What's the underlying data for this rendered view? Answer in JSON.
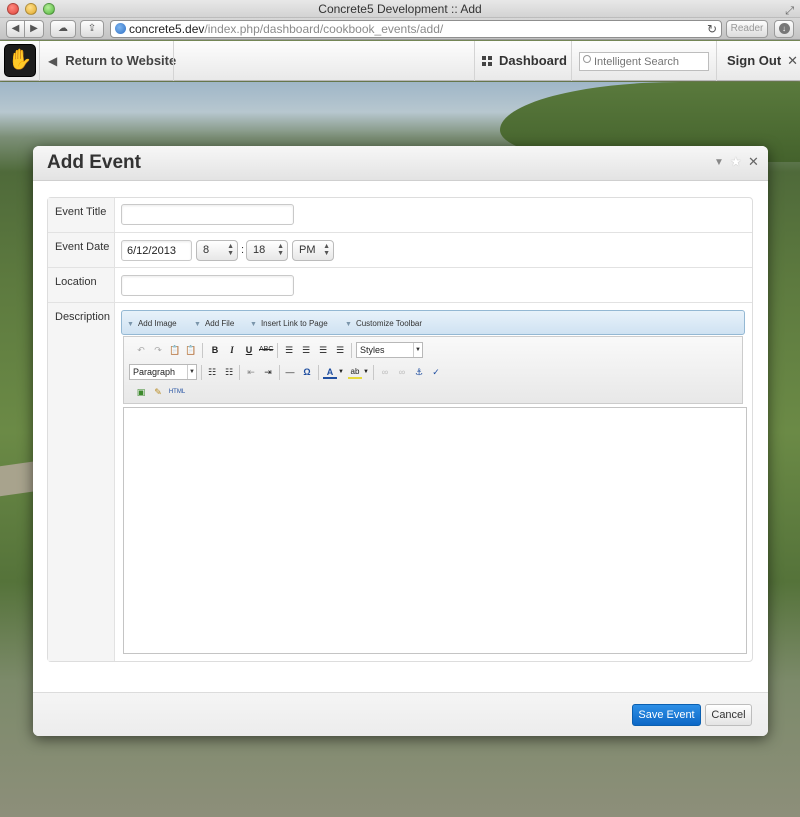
{
  "browser": {
    "window_title": "Concrete5 Development :: Add",
    "url_host": "concrete5.dev",
    "url_path": "/index.php/dashboard/cookbook_events/add/",
    "reader_label": "Reader"
  },
  "c5bar": {
    "return_label": "Return to Website",
    "dashboard_label": "Dashboard",
    "search_placeholder": "Intelligent Search",
    "signout_label": "Sign Out"
  },
  "dialog": {
    "title": "Add Event",
    "fields": {
      "title_label": "Event Title",
      "title_value": "",
      "date_label": "Event Date",
      "date_value": "6/12/2013",
      "hour_value": "8",
      "colon": ":",
      "minute_value": "18",
      "ampm_value": "PM",
      "location_label": "Location",
      "location_value": "",
      "description_label": "Description"
    },
    "editor_bar": {
      "add_image": "Add Image",
      "add_file": "Add File",
      "insert_link": "Insert Link to Page",
      "customize_toolbar": "Customize Toolbar"
    },
    "toolbar": {
      "styles_label": "Styles",
      "format_label": "Paragraph",
      "html_label": "HTML"
    },
    "footer": {
      "save_label": "Save Event",
      "cancel_label": "Cancel"
    }
  },
  "colors": {
    "primary_button": "#0c67c6",
    "editor_bar": "#cfe2f2"
  }
}
